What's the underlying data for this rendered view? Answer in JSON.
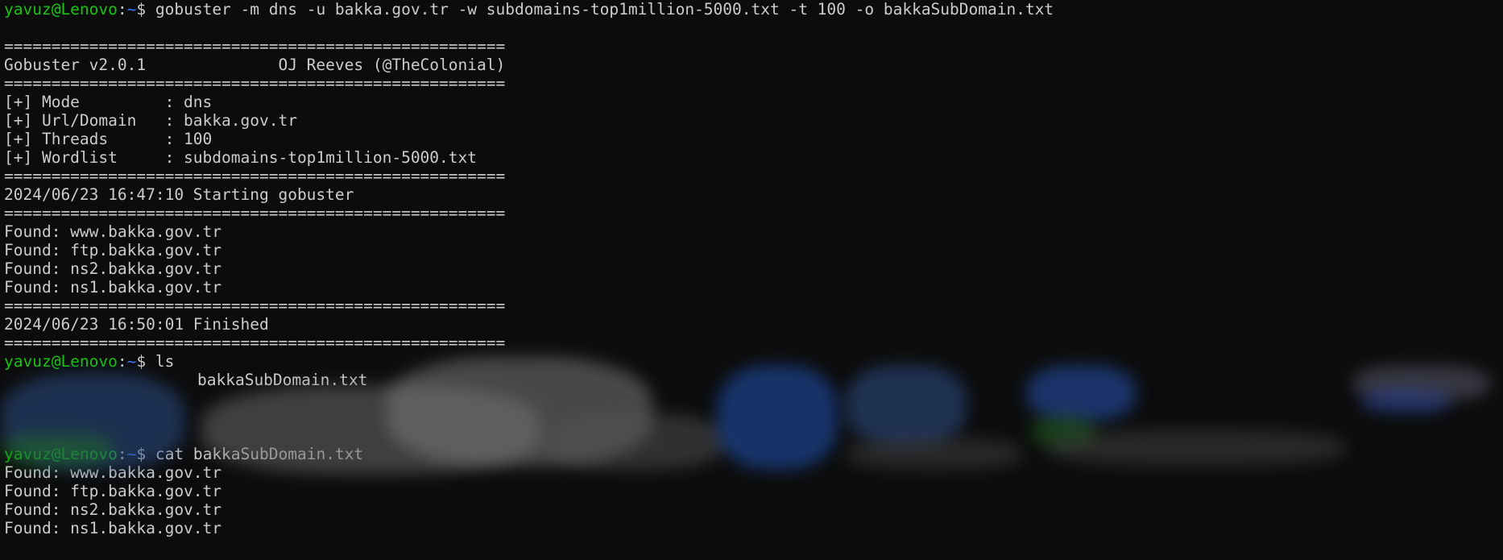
{
  "theme": {
    "background": "#0c0c0c",
    "foreground": "#cccccc",
    "prompt_user_color": "#16c60c",
    "prompt_path_color": "#3b78ff"
  },
  "prompt": {
    "user": "yavuz@Lenovo",
    "sep": ":",
    "path": "~",
    "sym": "$ "
  },
  "commands": {
    "gobuster": "gobuster -m dns -u bakka.gov.tr -w subdomains-top1million-5000.txt -t 100 -o bakkaSubDomain.txt",
    "ls": "ls",
    "cat": "cat bakkaSubDomain.txt"
  },
  "separator": "=====================================================",
  "banner": "Gobuster v2.0.1              OJ Reeves (@TheColonial)",
  "config": [
    "[+] Mode         : dns",
    "[+] Url/Domain   : bakka.gov.tr",
    "[+] Threads      : 100",
    "[+] Wordlist     : subdomains-top1million-5000.txt"
  ],
  "start_line": "2024/06/23 16:47:10 Starting gobuster",
  "found": [
    "Found: www.bakka.gov.tr",
    "Found: ftp.bakka.gov.tr",
    "Found: ns2.bakka.gov.tr",
    "Found: ns1.bakka.gov.tr"
  ],
  "finish_line": "2024/06/23 16:50:01 Finished",
  "ls_output": "bakkaSubDomain.txt",
  "cat_output": [
    "Found: www.bakka.gov.tr",
    "Found: ftp.bakka.gov.tr",
    "Found: ns2.bakka.gov.tr",
    "Found: ns1.bakka.gov.tr"
  ]
}
